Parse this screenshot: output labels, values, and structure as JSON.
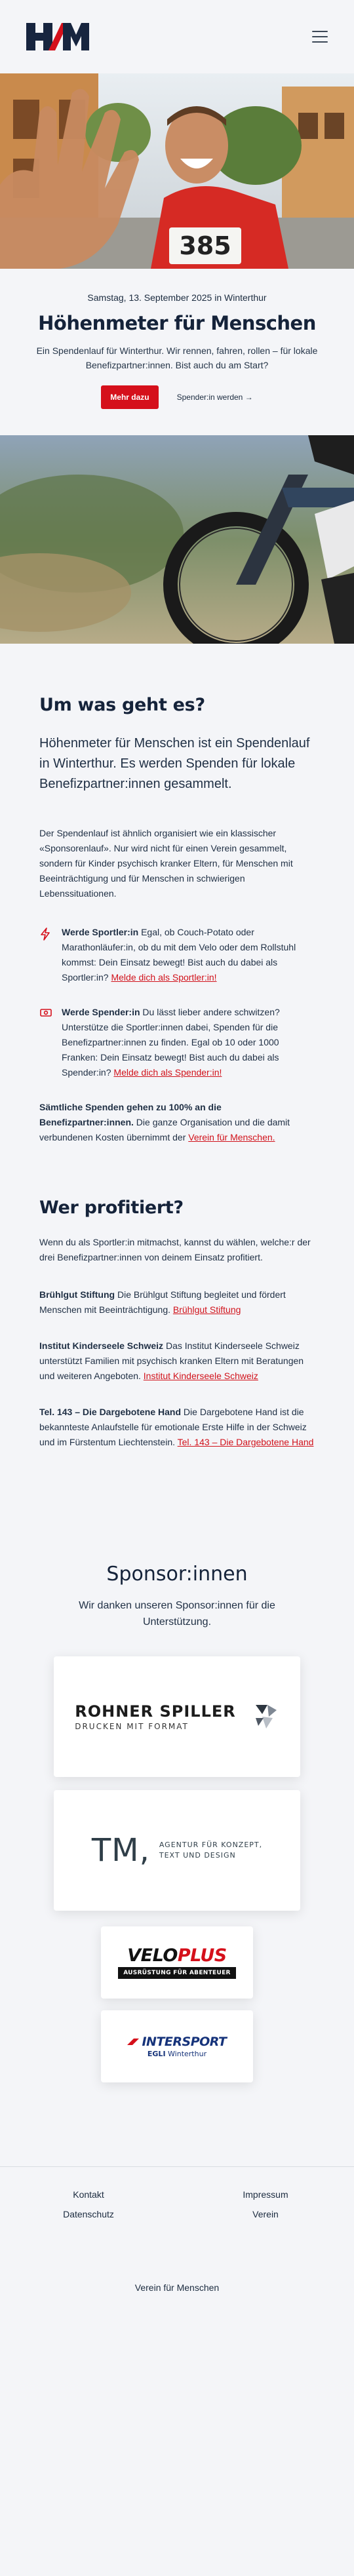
{
  "header": {
    "logo_text": "HfM",
    "menu_label": "Menü"
  },
  "hero": {
    "bib_number": "385",
    "date": "Samstag, 13. September 2025 in Winterthur",
    "title": "Höhenmeter für Menschen",
    "lead": "Ein Spendenlauf für Winterthur. Wir rennen, fahren, rollen – für lokale Benefizpartner:innen. Bist auch du am Start?",
    "primary_button": "Mehr dazu",
    "secondary_button": "Spender:in werden →"
  },
  "about": {
    "title": "Um was geht es?",
    "intro": "Höhenmeter für Menschen ist ein Spendenlauf in Winterthur. Es werden Spenden für lokale Benefizpartner:innen gesammelt.",
    "body": "Der Spendenlauf ist ähnlich organisiert wie ein klassischer «Sponsorenlauf». Nur wird nicht für einen Verein gesammelt, sondern für Kinder psychisch kranker Eltern, für Menschen mit Beeinträchtigung und für Menschen in schwierigen Lebenssituationen.",
    "runner": {
      "label": "Werde Sportler:in",
      "text": " Egal, ob Couch-Potato oder Marathonläufer:in, ob du mit dem Velo oder dem Rollstuhl kommst: Dein Einsatz bewegt! Bist auch du dabei als Sportler:in? ",
      "link": "Melde dich als Sportler:in!"
    },
    "donor": {
      "label": "Werde Spender:in",
      "text": " Du lässt lieber andere schwitzen? Unterstütze die Sportler:innen dabei, Spenden für die Benefizpartner:innen zu finden. Egal ob 10 oder 1000 Franken: Dein Einsatz bewegt! Bist auch du dabei als Spender:in? ",
      "link": "Melde dich als Spender:in!"
    },
    "note": {
      "bold": "Sämtliche Spenden gehen zu 100% an die Benefizpartner:innen.",
      "text": " Die ganze Organisation und die damit verbundenen Kosten übernimmt der ",
      "link": "Verein für Menschen."
    }
  },
  "beneficiaries": {
    "title": "Wer profitiert?",
    "intro": "Wenn du als Sportler:in mitmachst, kannst du wählen, welche:r der drei Benefizpartner:innen von deinem Einsatz profitiert.",
    "items": [
      {
        "name": "Brühlgut Stiftung",
        "text": " Die Brühlgut Stiftung begleitet und fördert Menschen mit Beeinträchtigung. ",
        "link": "Brühlgut Stiftung"
      },
      {
        "name": "Institut Kinderseele Schweiz",
        "text": " Das Institut Kinderseele Schweiz unterstützt Familien mit psychisch kranken Eltern mit Beratungen und weiteren Angeboten. ",
        "link": "Institut Kinderseele Schweiz"
      },
      {
        "name": "Tel. 143 – Die Dargebotene Hand",
        "text": " Die Dargebotene Hand ist die bekannteste Anlaufstelle für emotionale Erste Hilfe in der Schweiz und im Fürstentum Liechtenstein. ",
        "link": "Tel. 143 – Die Dargebotene Hand"
      }
    ]
  },
  "sponsors": {
    "title": "Sponsor:innen",
    "subtitle": "Wir danken unseren Sponsor:innen für die Unterstützung.",
    "rohner": {
      "name": "ROHNER SPILLER",
      "tagline": "DRUCKEN MIT FORMAT"
    },
    "tm": {
      "name": "TM,",
      "tagline_1": "AGENTUR FÜR KONZEPT,",
      "tagline_2": "TEXT UND DESIGN"
    },
    "veloplus": {
      "name_1": "VELO",
      "name_2": "PLUS",
      "tagline": "AUSRÜSTUNG FÜR ABENTEUER"
    },
    "intersport": {
      "name": "INTERSPORT",
      "sub_1": "EGLI",
      "sub_2": " Winterthur"
    }
  },
  "footer": {
    "links": [
      "Kontakt",
      "Impressum",
      "Datenschutz",
      "Verein"
    ],
    "bottom": "Verein für Menschen"
  },
  "colors": {
    "accent": "#d5101b",
    "navy": "#15233a",
    "background": "#f4f5f8"
  }
}
